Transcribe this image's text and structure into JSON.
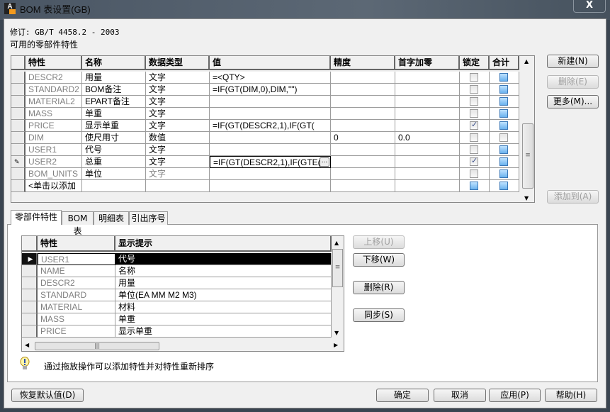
{
  "window": {
    "title": "BOM 表设置(GB)",
    "close": "X"
  },
  "revision": "修订: GB/T 4458.2 - 2003",
  "available_label": "可用的零部件特性",
  "top_grid": {
    "columns": [
      "特性",
      "名称",
      "数据类型",
      "值",
      "精度",
      "首字加零",
      "锁定",
      "合计"
    ],
    "rows": [
      {
        "prop": "DESCR2",
        "name": "用量",
        "type": "文字",
        "value": "=<QTY>",
        "precision": "",
        "lead": "",
        "lock": false,
        "sum": true
      },
      {
        "prop": "STANDARD2",
        "name": "BOM备注",
        "type": "文字",
        "value": "=IF(GT(DIM,0),DIM,\"\")",
        "precision": "",
        "lead": "",
        "lock": false,
        "sum": true
      },
      {
        "prop": "MATERIAL2",
        "name": "EPART备注",
        "type": "文字",
        "value": "",
        "precision": "",
        "lead": "",
        "lock": false,
        "sum": true
      },
      {
        "prop": "MASS",
        "name": "单重",
        "type": "文字",
        "value": "",
        "precision": "",
        "lead": "",
        "lock": false,
        "sum": true
      },
      {
        "prop": "PRICE",
        "name": "显示单重",
        "type": "文字",
        "value": "=IF(GT(DESCR2,1),IF(GT(",
        "precision": "",
        "lead": "",
        "lock": true,
        "sum": true
      },
      {
        "prop": "DIM",
        "name": "使尺用寸",
        "type": "数值",
        "value": "",
        "precision": "0",
        "lead": "0.0",
        "lock": false,
        "sum": false
      },
      {
        "prop": "USER1",
        "name": "代号",
        "type": "文字",
        "value": "",
        "precision": "",
        "lead": "",
        "lock": false,
        "sum": true
      },
      {
        "prop": "USER2",
        "name": "总重",
        "type": "文字",
        "value": "=IF(GT(DESCR2,1),IF(GTE(",
        "precision": "",
        "lead": "",
        "lock": true,
        "sum": true,
        "editing": true
      },
      {
        "prop": "BOM_UNITS",
        "name": "单位",
        "type": "文字",
        "value": "",
        "precision": "",
        "lead": "",
        "lock": false,
        "sum": true,
        "type_gray": true
      },
      {
        "prop": "<单击以添加",
        "name": "",
        "type": "",
        "value": "",
        "precision": "",
        "lead": "",
        "lock": true,
        "sum": true,
        "add_row": true
      }
    ],
    "ellipsis": "..."
  },
  "right_buttons": {
    "new": "新建(N)",
    "delete": "删除(E)",
    "more": "更多(M)...",
    "add_to": "添加到(A)"
  },
  "tabs": [
    "零部件特性",
    "BOM 表",
    "明细表",
    "引出序号"
  ],
  "inner_grid": {
    "columns": [
      "特性",
      "显示提示"
    ],
    "rows": [
      {
        "prop": "USER1",
        "hint": "代号",
        "selected": true
      },
      {
        "prop": "NAME",
        "hint": "名称"
      },
      {
        "prop": "DESCR2",
        "hint": "用量"
      },
      {
        "prop": "STANDARD",
        "hint": "单位(EA MM M2 M3)"
      },
      {
        "prop": "MATERIAL",
        "hint": "材料"
      },
      {
        "prop": "MASS",
        "hint": "单重"
      },
      {
        "prop": "PRICE",
        "hint": "显示单重"
      }
    ]
  },
  "inner_buttons": {
    "up": "上移(U)",
    "down": "下移(W)",
    "delete": "删除(R)",
    "sync": "同步(S)"
  },
  "hint": "通过拖放操作可以添加特性并对特性重新排序",
  "footer": {
    "restore": "恢复默认值(D)",
    "ok": "确定",
    "cancel": "取消",
    "apply": "应用(P)",
    "help": "帮助(H)"
  }
}
